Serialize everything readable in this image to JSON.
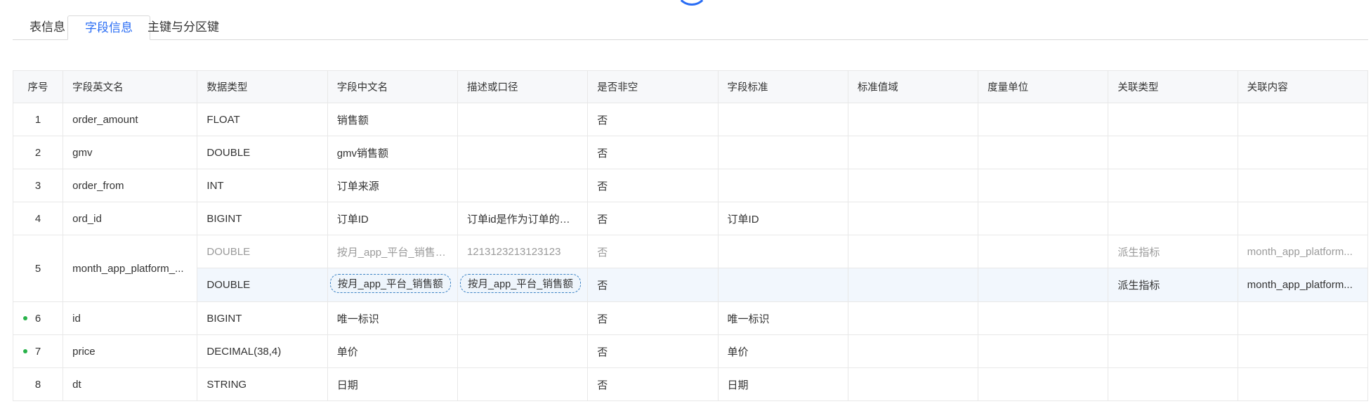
{
  "colors": {
    "accent": "#2a6df4",
    "status_dot": "#28b24a"
  },
  "tabs": [
    {
      "label": "表信息",
      "active": false
    },
    {
      "label": "字段信息",
      "active": true
    },
    {
      "label": "主键与分区键",
      "active": false
    }
  ],
  "table": {
    "headers": [
      "序号",
      "字段英文名",
      "数据类型",
      "字段中文名",
      "描述或口径",
      "是否非空",
      "字段标准",
      "标准值域",
      "度量单位",
      "关联类型",
      "关联内容"
    ],
    "rows": [
      {
        "idx": "1",
        "en": "order_amount",
        "type": "FLOAT",
        "cn": "销售额",
        "desc": "",
        "notnull": "否",
        "std": "",
        "range": "",
        "unit": "",
        "reltype": "",
        "relcontent": ""
      },
      {
        "idx": "2",
        "en": "gmv",
        "type": "DOUBLE",
        "cn": "gmv销售额",
        "desc": "",
        "notnull": "否",
        "std": "",
        "range": "",
        "unit": "",
        "reltype": "",
        "relcontent": ""
      },
      {
        "idx": "3",
        "en": "order_from",
        "type": "INT",
        "cn": "订单来源",
        "desc": "",
        "notnull": "否",
        "std": "",
        "range": "",
        "unit": "",
        "reltype": "",
        "relcontent": ""
      },
      {
        "idx": "4",
        "en": "ord_id",
        "type": "BIGINT",
        "cn": "订单ID",
        "desc": "订单id是作为订单的唯...",
        "notnull": "否",
        "std": "订单ID",
        "range": "",
        "unit": "",
        "reltype": "",
        "relcontent": ""
      },
      {
        "idx": "5",
        "en": "month_app_platform_...",
        "old": {
          "type": "DOUBLE",
          "cn": "按月_app_平台_销售额...",
          "desc": "1213123213123123",
          "notnull": "否",
          "std": "",
          "range": "",
          "unit": "",
          "reltype": "派生指标",
          "relcontent": "month_app_platform..."
        },
        "new": {
          "type": "DOUBLE",
          "cn": "按月_app_平台_销售额",
          "desc": "按月_app_平台_销售额",
          "notnull": "否",
          "std": "",
          "range": "",
          "unit": "",
          "reltype": "派生指标",
          "relcontent": "month_app_platform..."
        }
      },
      {
        "idx": "6",
        "en": "id",
        "type": "BIGINT",
        "cn": "唯一标识",
        "desc": "",
        "notnull": "否",
        "std": "唯一标识",
        "range": "",
        "unit": "",
        "reltype": "",
        "relcontent": ""
      },
      {
        "idx": "7",
        "en": "price",
        "type": "DECIMAL(38,4)",
        "cn": "单价",
        "desc": "",
        "notnull": "否",
        "std": "单价",
        "range": "",
        "unit": "",
        "reltype": "",
        "relcontent": ""
      },
      {
        "idx": "8",
        "en": "dt",
        "type": "STRING",
        "cn": "日期",
        "desc": "",
        "notnull": "否",
        "std": "日期",
        "range": "",
        "unit": "",
        "reltype": "",
        "relcontent": ""
      }
    ]
  }
}
